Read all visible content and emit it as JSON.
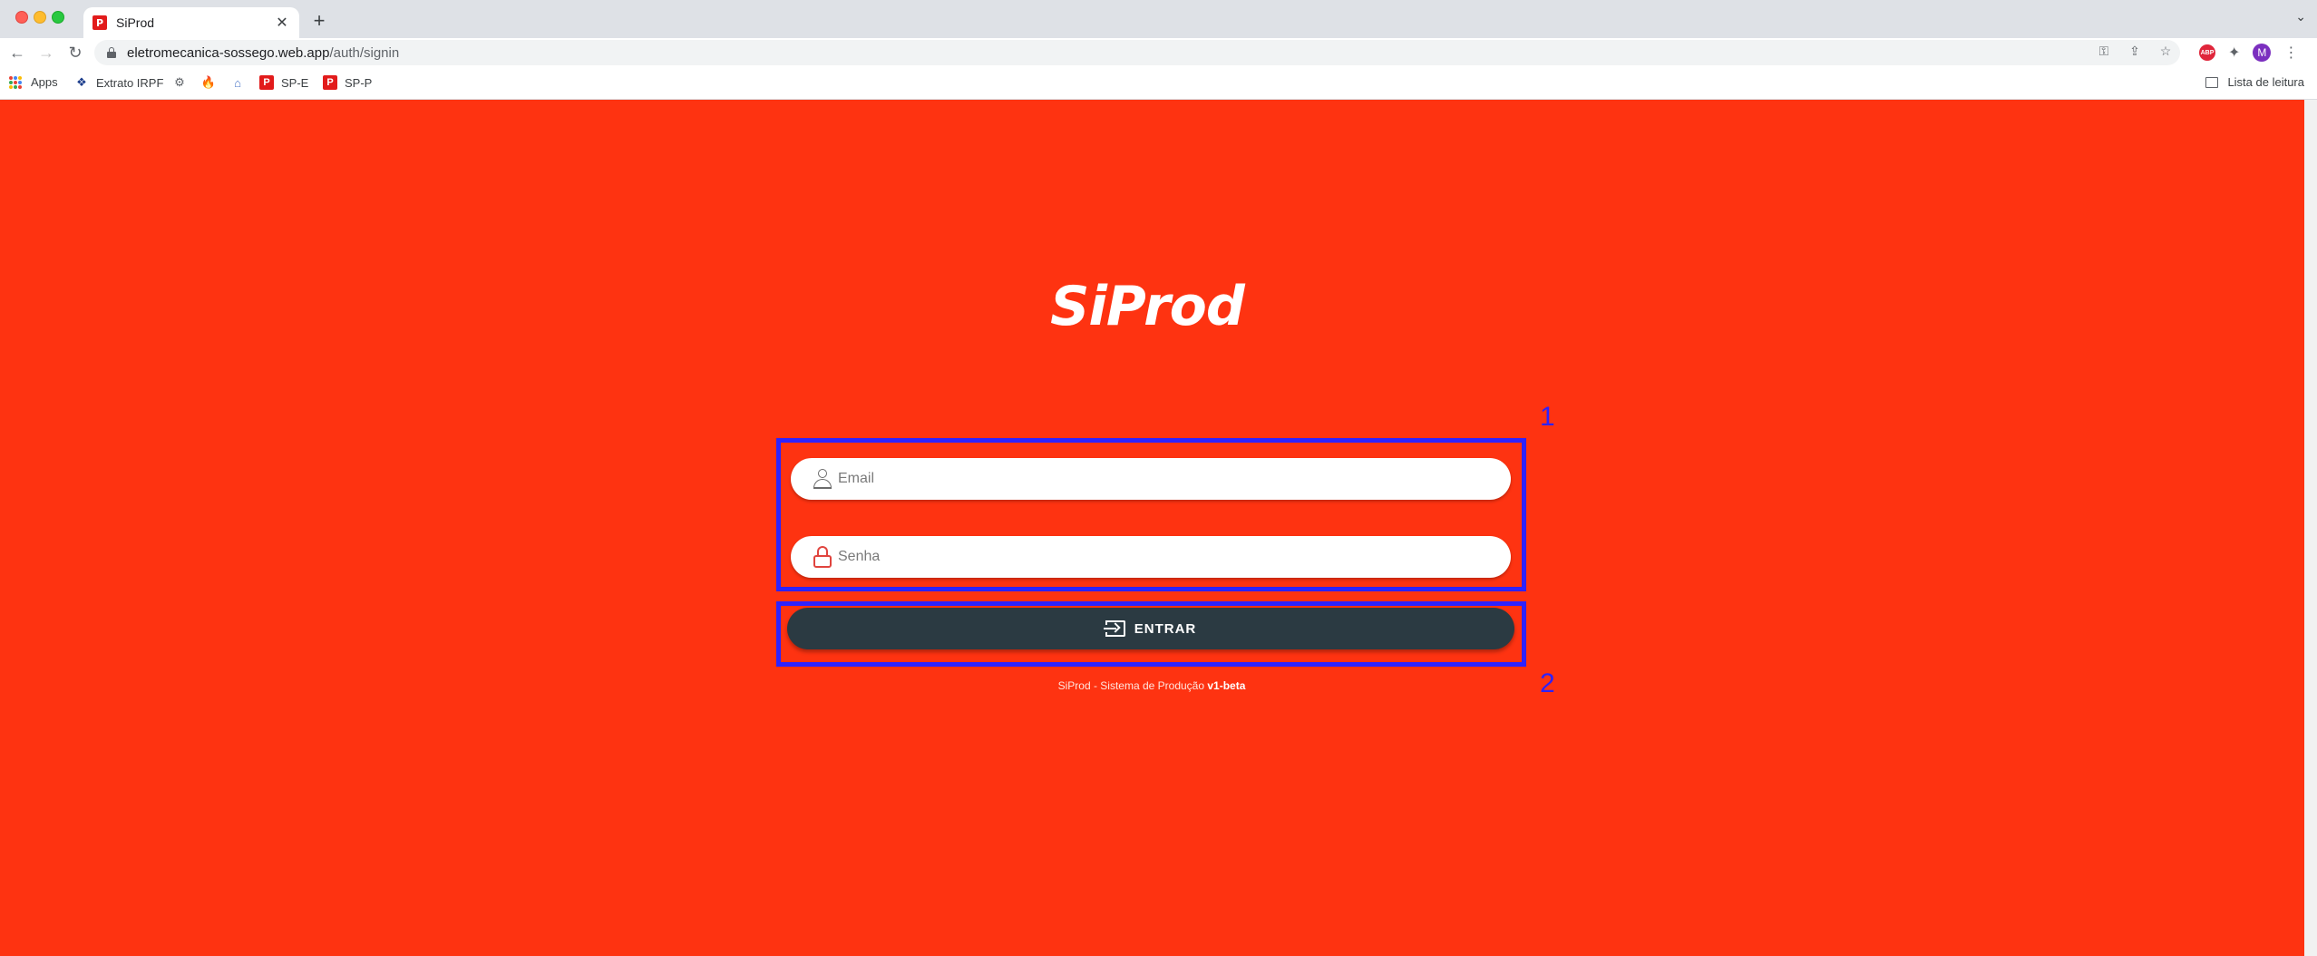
{
  "browser": {
    "tab_title": "SiProd",
    "url_host": "eletromecanica-sossego.web.app",
    "url_path": "/auth/signin",
    "avatar_letter": "M",
    "bookmarks": [
      {
        "label": "Apps",
        "icon": "apps-grid-icon"
      },
      {
        "label": "Extrato IRPF",
        "icon": "receita-icon"
      },
      {
        "label": "",
        "icon": "settings-icon"
      },
      {
        "label": "",
        "icon": "firebase-icon"
      },
      {
        "label": "",
        "icon": "home-icon"
      },
      {
        "label": "SP-E",
        "icon": "siprod-icon"
      },
      {
        "label": "SP-P",
        "icon": "siprod-icon"
      }
    ],
    "reading_list": "Lista de leitura"
  },
  "login": {
    "logo_text": "SiProd",
    "email_placeholder": "Email",
    "password_placeholder": "Senha",
    "submit_label": "ENTRAR",
    "footer_prefix": "SiProd - Sistema de Produção",
    "footer_version": "v1-beta"
  },
  "annotations": {
    "box1_number": "1",
    "box2_number": "2"
  },
  "colors": {
    "page_background": "#fe3311",
    "button_background": "#2b3a42",
    "annotation": "#2d22ff"
  }
}
